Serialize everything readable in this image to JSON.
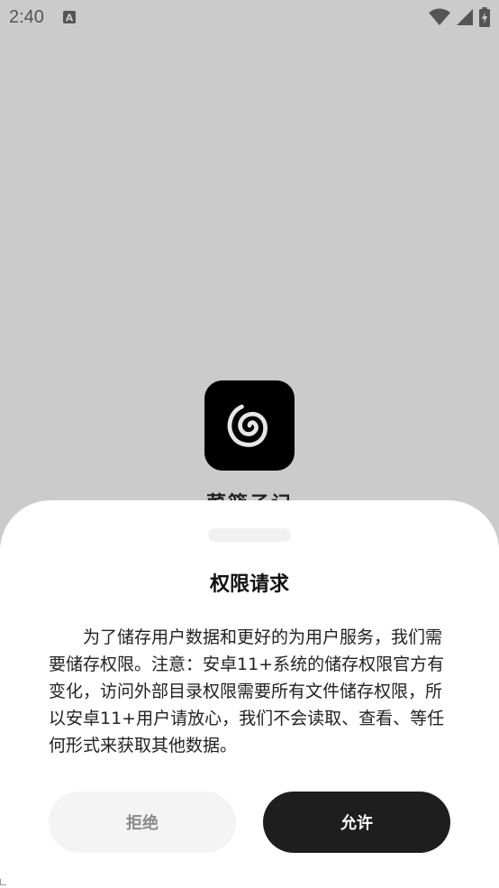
{
  "status_bar": {
    "time": "2:40",
    "notification_icon_letter": "A",
    "icons": [
      "wifi-icon",
      "signal-icon",
      "battery-charging-icon"
    ]
  },
  "app": {
    "name": "菜篮子记",
    "icon": "spiral-icon"
  },
  "dialog": {
    "title": "权限请求",
    "body": "为了储存用户数据和更好的为用户服务，我们需要储存权限。注意：安卓11+系统的储存权限官方有变化，访问外部目录权限需要所有文件储存权限，所以安卓11+用户请放心，我们不会读取、查看、等任何形式来获取其他数据。",
    "refuse_label": "拒绝",
    "allow_label": "允许"
  },
  "colors": {
    "scrim": "#cbcbcb",
    "sheet": "#ffffff",
    "primary_button": "#1e1e1e",
    "secondary_button": "#f4f4f4"
  }
}
